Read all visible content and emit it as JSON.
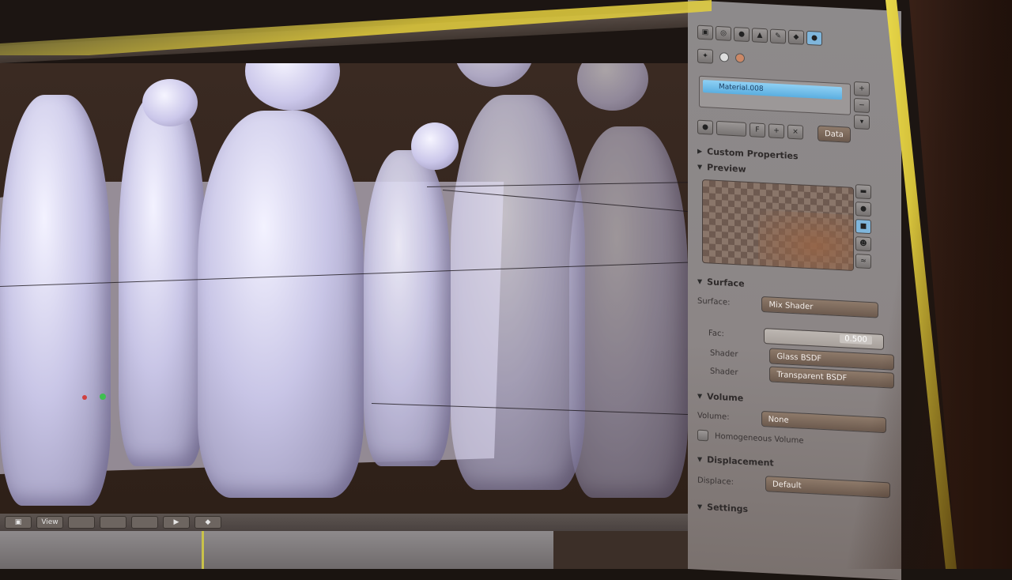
{
  "properties": {
    "material_slot": "Material.008",
    "data_button": "Data",
    "sections": {
      "custom_properties": "Custom Properties",
      "preview": "Preview",
      "surface": "Surface",
      "volume": "Volume",
      "displacement": "Displacement",
      "settings": "Settings"
    },
    "surface": {
      "surface_label": "Surface:",
      "surface_value": "Mix Shader",
      "fac_label": "Fac:",
      "fac_value": "0.500",
      "shader1_label": "Shader",
      "shader1_value": "Glass BSDF",
      "shader2_label": "Shader",
      "shader2_value": "Transparent BSDF"
    },
    "volume": {
      "volume_label": "Volume:",
      "volume_value": "None",
      "homogeneous_label": "Homogeneous Volume"
    },
    "displacement": {
      "label": "Displace:",
      "value": "Default"
    }
  },
  "viewport": {
    "footer_view": "View"
  },
  "colors": {
    "accent_yellow": "#e6d64a",
    "selection_blue": "#5aaee0",
    "panel_bg": "#8c8686"
  }
}
